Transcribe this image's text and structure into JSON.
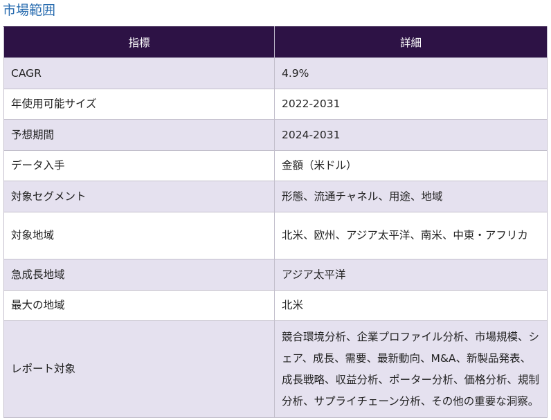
{
  "section": {
    "title": "市場範囲"
  },
  "table": {
    "headers": [
      "指標",
      "詳細"
    ],
    "rows": [
      {
        "metric": "CAGR",
        "detail": "4.9%"
      },
      {
        "metric": "年使用可能サイズ",
        "detail": "2022-2031"
      },
      {
        "metric": "予想期間",
        "detail": "2024-2031"
      },
      {
        "metric": "データ入手",
        "detail": "金額（米ドル）"
      },
      {
        "metric": "対象セグメント",
        "detail": "形態、流通チャネル、用途、地域"
      },
      {
        "metric": "対象地域",
        "detail": "北米、欧州、アジア太平洋、南米、中東・アフリカ"
      },
      {
        "metric": "急成長地域",
        "detail": "アジア太平洋"
      },
      {
        "metric": "最大の地域",
        "detail": "北米"
      },
      {
        "metric": "レポート対象",
        "detail": "競合環境分析、企業プロファイル分析、市場規模、シェア、成長、需要、最新動向、M&A、新製品発表、成長戦略、収益分析、ポーター分析、価格分析、規制分析、サプライチェーン分析、その他の重要な洞察。"
      }
    ]
  },
  "colors": {
    "header_bg": "#2d1245",
    "header_text": "#ffffff",
    "row_alt_bg": "#e5e1ef",
    "title_text": "#2a6db0"
  }
}
